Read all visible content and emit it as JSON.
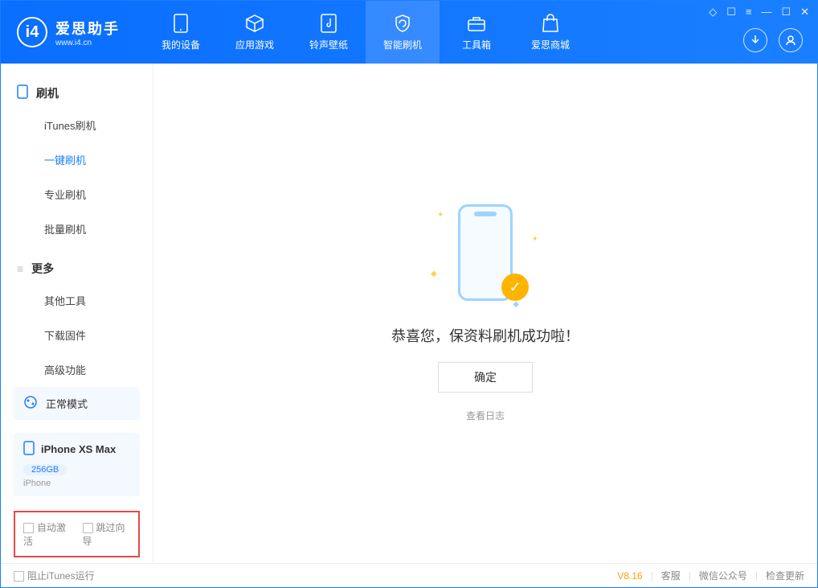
{
  "app": {
    "name_cn": "爱思助手",
    "name_en": "www.i4.cn"
  },
  "tabs": [
    {
      "label": "我的设备"
    },
    {
      "label": "应用游戏"
    },
    {
      "label": "铃声壁纸"
    },
    {
      "label": "智能刷机"
    },
    {
      "label": "工具箱"
    },
    {
      "label": "爱思商城"
    }
  ],
  "sidebar": {
    "section_flash": "刷机",
    "items_flash": [
      {
        "label": "iTunes刷机"
      },
      {
        "label": "一键刷机"
      },
      {
        "label": "专业刷机"
      },
      {
        "label": "批量刷机"
      }
    ],
    "section_more": "更多",
    "items_more": [
      {
        "label": "其他工具"
      },
      {
        "label": "下载固件"
      },
      {
        "label": "高级功能"
      }
    ]
  },
  "mode": {
    "label": "正常模式"
  },
  "device": {
    "name": "iPhone XS Max",
    "storage": "256GB",
    "type": "iPhone"
  },
  "options": {
    "auto_activate": "自动激活",
    "skip_guide": "跳过向导"
  },
  "main": {
    "success_text": "恭喜您，保资料刷机成功啦！",
    "ok_label": "确定",
    "log_link": "查看日志"
  },
  "footer": {
    "block_itunes": "阻止iTunes运行",
    "version": "V8.16",
    "links": [
      "客服",
      "微信公众号",
      "检查更新"
    ]
  }
}
